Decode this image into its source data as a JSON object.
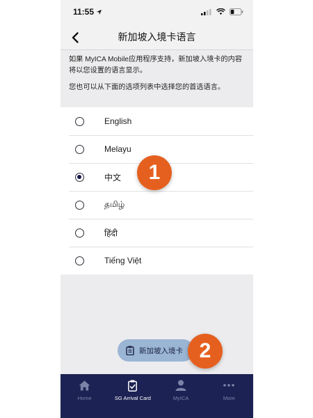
{
  "status_bar": {
    "time": "11:55"
  },
  "header": {
    "title": "新加坡入境卡语言"
  },
  "description": {
    "line1": "如果 MyICA Mobile应用程序支持，新加坡入境卡的内容将以您设置的语言显示。",
    "line2": "您也可以从下面的选项列表中选择您的首选语言。"
  },
  "languages": [
    {
      "label": "English",
      "selected": false
    },
    {
      "label": "Melayu",
      "selected": false
    },
    {
      "label": "中文",
      "selected": true
    },
    {
      "label": "தமிழ்",
      "selected": false
    },
    {
      "label": "हिंदी",
      "selected": false
    },
    {
      "label": "Tiếng Việt",
      "selected": false
    }
  ],
  "fab": {
    "label": "新加坡入境卡",
    "icon": "clipboard-icon"
  },
  "tabbar": {
    "items": [
      {
        "label": "Home",
        "icon": "home-icon",
        "active": false
      },
      {
        "label": "SG Arrival Card",
        "icon": "clipboard-check-icon",
        "active": true
      },
      {
        "label": "MyICA",
        "icon": "person-icon",
        "active": false
      },
      {
        "label": "More",
        "icon": "more-dots-icon",
        "active": false
      }
    ]
  },
  "annotations": {
    "step1": "1",
    "step2": "2"
  },
  "colors": {
    "accent_orange": "#e5601f",
    "tabbar_navy": "#1c2253",
    "fab_blue": "#9bb5d5",
    "selected_radio": "#17184a"
  }
}
